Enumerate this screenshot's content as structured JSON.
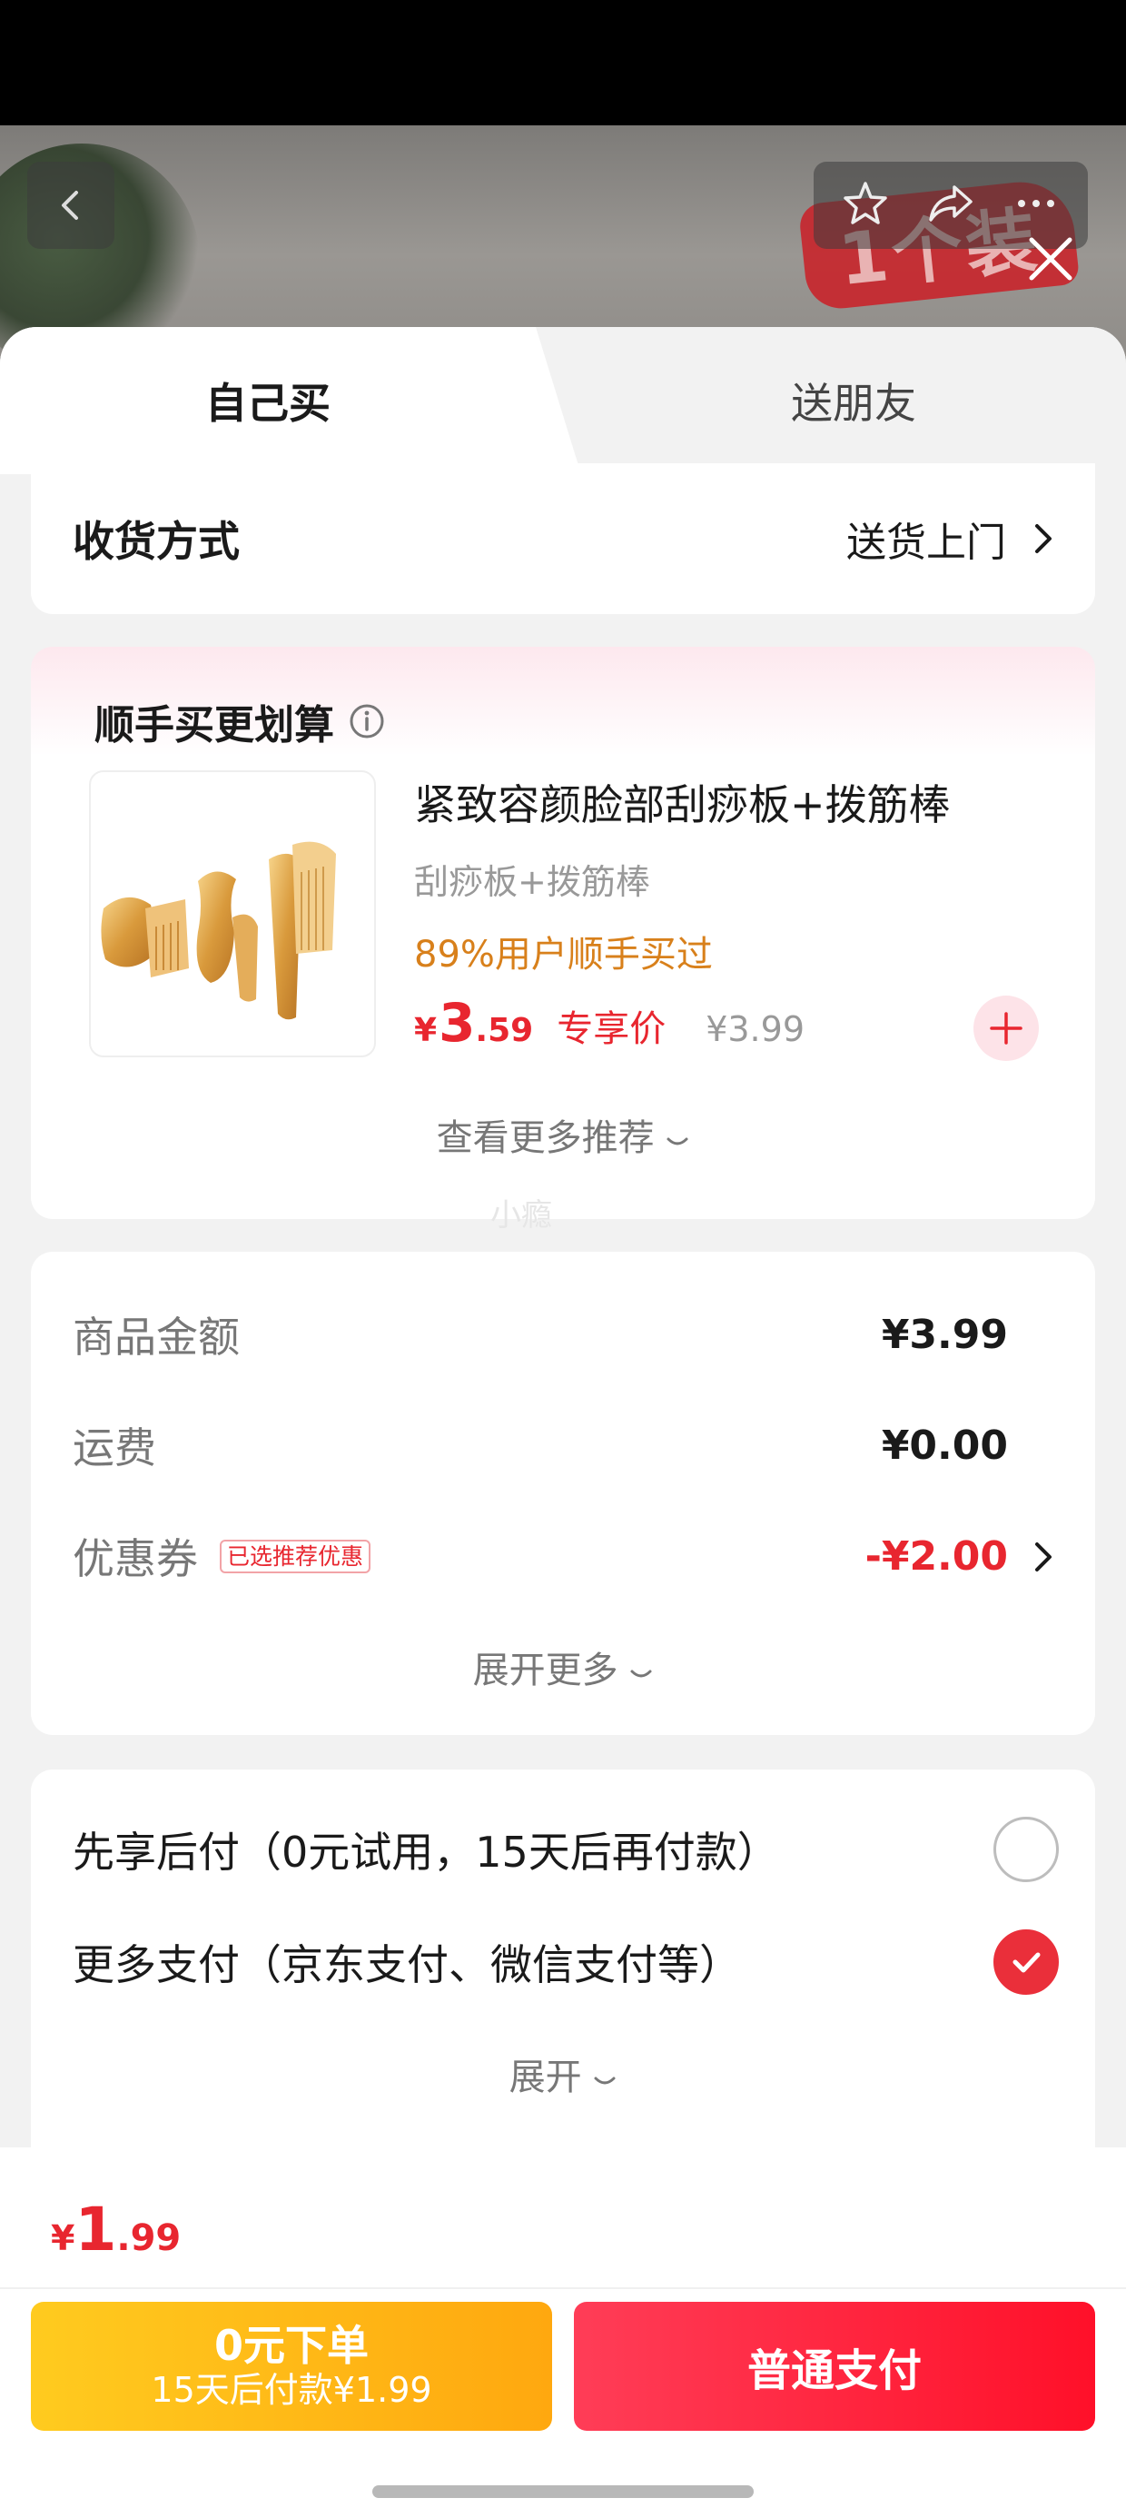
{
  "tabs": {
    "self": "自己买",
    "friend": "送朋友"
  },
  "background_banner": {
    "badge_text": "1个装"
  },
  "delivery": {
    "label": "收货方式",
    "value": "送货上门"
  },
  "addon": {
    "title": "顺手买更划算",
    "product_name": "紧致容颜脸部刮痧板+拨筋棒",
    "subtitle": "刮痧板+拨筋棒",
    "stat": "89%用户顺手买过",
    "price_symbol": "¥",
    "price_int": "3",
    "price_dec": ".59",
    "price_tag": "专享价",
    "original_price": "¥3.99",
    "more": "查看更多推荐"
  },
  "watermark": "小瘾",
  "summary": {
    "goods_label": "商品金额",
    "goods_value": "¥3.99",
    "shipping_label": "运费",
    "shipping_value": "¥0.00",
    "coupon_label": "优惠券",
    "coupon_badge": "已选推荐优惠",
    "coupon_value": "-¥2.00",
    "expand_more": "展开更多"
  },
  "payment": {
    "option1": "先享后付（0元试用，15天后再付款）",
    "option2": "更多支付（京东支付、微信支付等）",
    "option1_selected": false,
    "option2_selected": true,
    "expand": "展开"
  },
  "footer": {
    "total_symbol": "¥",
    "total_int": "1",
    "total_dec": ".99",
    "zero_title": "0元下单",
    "zero_sub": "15天后付款¥1.99",
    "normal_pay": "普通支付"
  },
  "colors": {
    "accent_red": "#e8262f",
    "stat_orange": "#d8801b",
    "yellow_btn": "#ffb514",
    "red_btn": "#ff1f3d"
  }
}
